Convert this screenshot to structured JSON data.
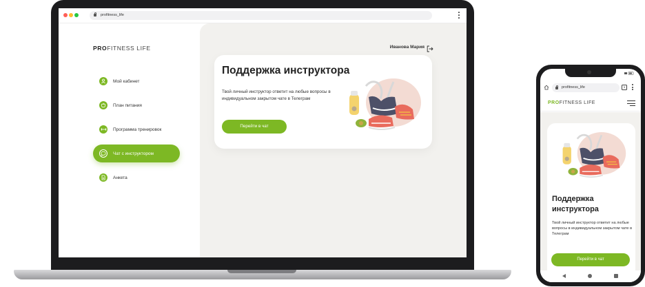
{
  "browser": {
    "url": "profitness_life"
  },
  "brand": {
    "logo_bold": "PRO",
    "logo_thin": "FITNESS LIFE",
    "accent_color": "#7db824",
    "background_color": "#f2f1ee"
  },
  "header": {
    "user_name": "Иванова Мария",
    "logout_icon": "logout-icon"
  },
  "sidebar": {
    "items": [
      {
        "label": "Мой кабинет",
        "icon": "user-icon",
        "active": false
      },
      {
        "label": "План питания",
        "icon": "apple-icon",
        "active": false
      },
      {
        "label": "Программа тренировок",
        "icon": "dumbbell-icon",
        "active": false
      },
      {
        "label": "Чат с инструктором",
        "icon": "chat-icon",
        "active": true
      },
      {
        "label": "Анкета",
        "icon": "document-icon",
        "active": false
      }
    ]
  },
  "card": {
    "title": "Поддержка инструктора",
    "text": "Твой личный инструктор ответит на любые вопросы в индивидуальном закрытом чате в Телеграм",
    "button_label": "Перейти в чат"
  },
  "mobile": {
    "url": "profitness_life",
    "tab_count": "1",
    "title": "Поддержка инструктора",
    "text": "Твой личный инструктор ответит на любые вопросы в индивидуальном закрытом чате в Телеграм",
    "button_label": "Перейти в чат"
  }
}
